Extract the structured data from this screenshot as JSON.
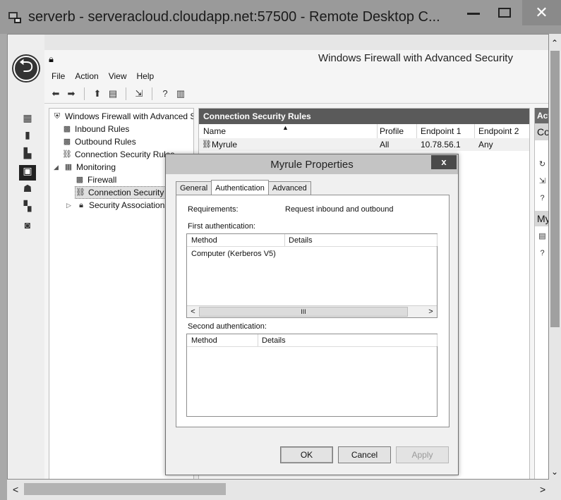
{
  "remote_window": {
    "title": "serverb - serveracloud.cloudapp.net:57500 - Remote Desktop C...",
    "close_glyph": "✕"
  },
  "server_manager": {
    "back_glyph": "⮌"
  },
  "mmc": {
    "title": "Windows Firewall with Advanced Security",
    "menu": [
      "File",
      "Action",
      "View",
      "Help"
    ]
  },
  "tree": {
    "root": "Windows Firewall with Advanced Security",
    "inbound": "Inbound Rules",
    "outbound": "Outbound Rules",
    "connection_security": "Connection Security Rules",
    "monitoring": "Monitoring",
    "firewall": "Firewall",
    "mon_connection_security": "Connection Security Rules",
    "security_associations": "Security Associations"
  },
  "center": {
    "header": "Connection Security Rules",
    "columns": {
      "name": "Name",
      "profile": "Profile",
      "endpoint1": "Endpoint 1",
      "endpoint2": "Endpoint 2"
    },
    "rows": [
      {
        "name": "Myrule",
        "profile": "All",
        "endpoint1": "10.78.56.1",
        "endpoint2": "Any"
      }
    ]
  },
  "actions": {
    "header": "Actions",
    "section1": "Connection Security Rules",
    "section2": "Myrule"
  },
  "dialog": {
    "title": "Myrule Properties",
    "close_glyph": "x",
    "tabs": [
      "General",
      "Authentication",
      "Advanced"
    ],
    "active_tab": "Authentication",
    "requirements_label": "Requirements:",
    "requirements_value": "Request inbound and outbound",
    "first_auth_label": "First authentication:",
    "second_auth_label": "Second authentication:",
    "list_columns": {
      "method": "Method",
      "details": "Details"
    },
    "first_auth_rows": [
      {
        "method": "Computer (Kerberos V5)",
        "details": ""
      }
    ],
    "scroll_thumb": "III",
    "buttons": {
      "ok": "OK",
      "cancel": "Cancel",
      "apply": "Apply"
    }
  }
}
